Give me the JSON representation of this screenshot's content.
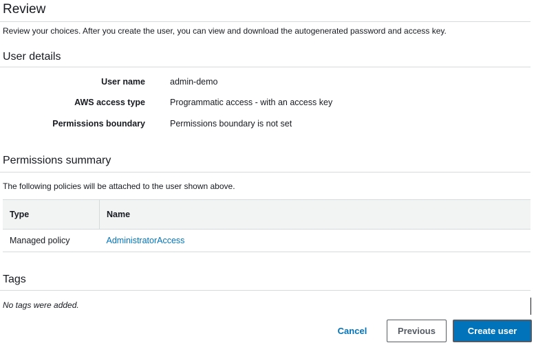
{
  "review": {
    "title": "Review",
    "intro": "Review your choices. After you create the user, you can view and download the autogenerated password and access key."
  },
  "user_details": {
    "title": "User details",
    "rows": [
      {
        "label": "User name",
        "value": "admin-demo"
      },
      {
        "label": "AWS access type",
        "value": "Programmatic access - with an access key"
      },
      {
        "label": "Permissions boundary",
        "value": "Permissions boundary is not set"
      }
    ]
  },
  "permissions": {
    "title": "Permissions summary",
    "description": "The following policies will be attached to the user shown above.",
    "columns": [
      "Type",
      "Name"
    ],
    "rows": [
      {
        "type": "Managed policy",
        "name": "AdministratorAccess"
      }
    ]
  },
  "tags": {
    "title": "Tags",
    "empty_text": "No tags were added."
  },
  "actions": {
    "cancel_label": "Cancel",
    "previous_label": "Previous",
    "create_label": "Create user"
  },
  "colors": {
    "link": "#0073bb",
    "primary_button": "#0073bb",
    "divider": "#d5dbdb",
    "table_header_bg": "#f2f3f3"
  }
}
